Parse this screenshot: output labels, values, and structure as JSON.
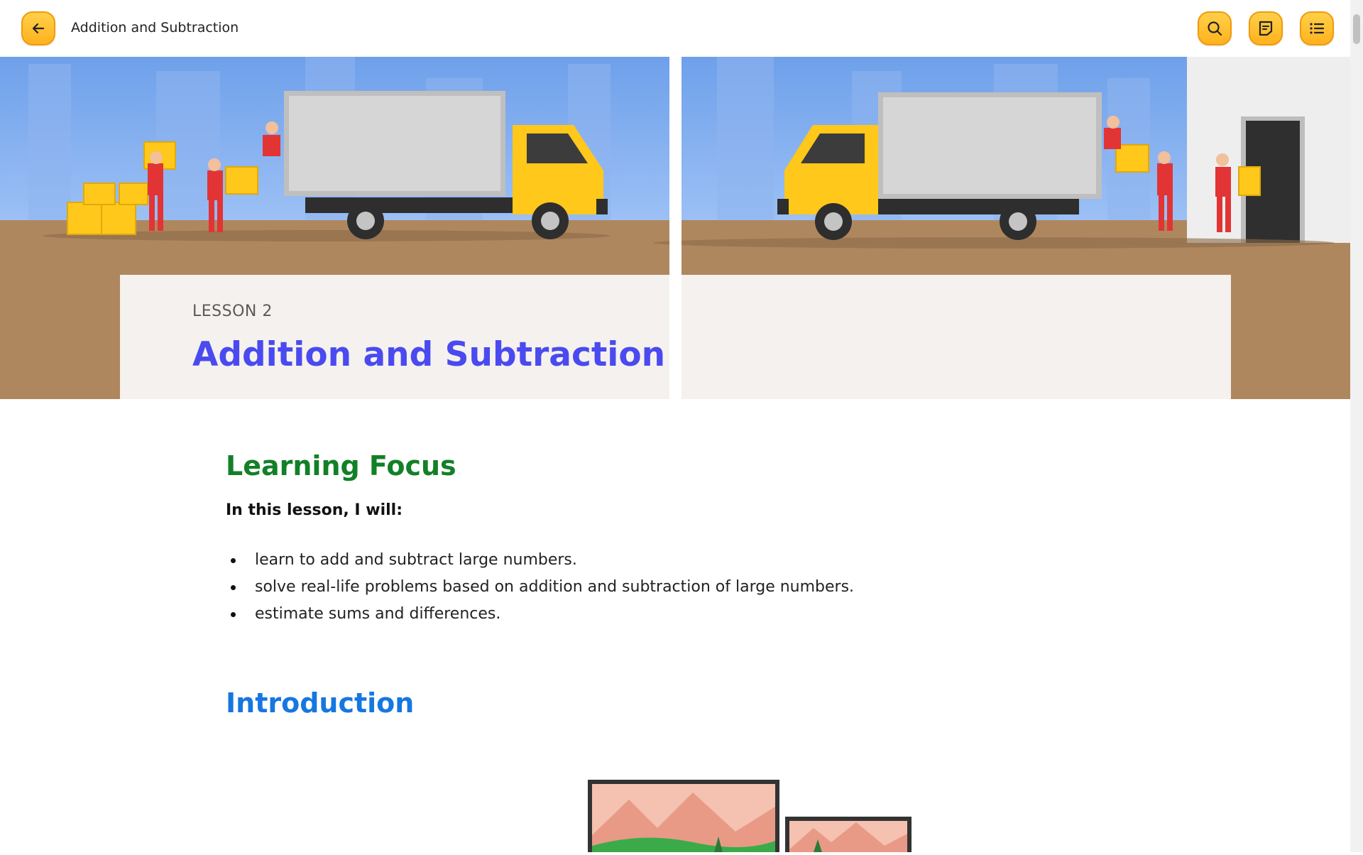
{
  "topbar": {
    "title": "Addition and Subtraction",
    "back_icon": "back-arrow-icon",
    "search_icon": "search-icon",
    "notes_icon": "notes-icon",
    "contents_icon": "list-icon"
  },
  "hero": {
    "lesson_label": "LESSON 2",
    "lesson_title": "Addition and Subtraction"
  },
  "learning_focus": {
    "heading": "Learning Focus",
    "intro": "In this lesson, I will:",
    "items": [
      "learn to add and subtract large numbers.",
      "solve real-life problems based on addition and subtraction of large numbers.",
      "estimate sums and differences."
    ]
  },
  "introduction": {
    "heading": "Introduction"
  },
  "colors": {
    "accent_button": "#ffc22e",
    "lesson_title": "#4a4af0",
    "focus_heading": "#128027",
    "intro_heading": "#1677e0",
    "hero_ground": "#af875f",
    "panel": "#f5f1ee"
  }
}
